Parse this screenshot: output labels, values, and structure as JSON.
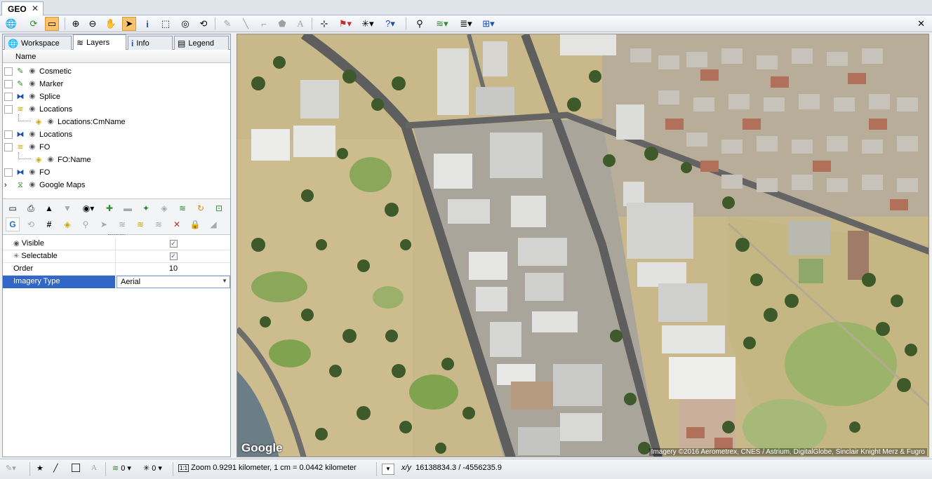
{
  "document_tab": {
    "title": "GEO",
    "close": "✕"
  },
  "toolbar": {
    "close": "✕"
  },
  "panel_tabs": [
    {
      "label": "Workspace",
      "icon": "globe-icon"
    },
    {
      "label": "Layers",
      "icon": "layers-icon"
    },
    {
      "label": "Info",
      "icon": "info-icon"
    },
    {
      "label": "Legend",
      "icon": "legend-icon"
    }
  ],
  "tree": {
    "column_header": "Name",
    "layers": [
      {
        "label": "Cosmetic",
        "icon": "cosmetic-layer-icon",
        "child": false
      },
      {
        "label": "Marker",
        "icon": "marker-layer-icon",
        "child": false
      },
      {
        "label": "Splice",
        "icon": "splice-layer-icon",
        "child": false
      },
      {
        "label": "Locations",
        "icon": "locations-layer-icon",
        "child": false
      },
      {
        "label": "Locations:CmName",
        "icon": "label-tag-icon",
        "child": true
      },
      {
        "label": "Locations",
        "icon": "locations-layer-icon",
        "child": false
      },
      {
        "label": "FO",
        "icon": "fo-layer-icon",
        "child": false
      },
      {
        "label": "FO:Name",
        "icon": "label-tag-icon",
        "child": true
      },
      {
        "label": "FO",
        "icon": "fo-layer-icon",
        "child": false
      },
      {
        "label": "Google Maps",
        "icon": "google-maps-layer-icon",
        "child": false
      }
    ]
  },
  "properties": {
    "visible": {
      "name": "Visible",
      "checked": "✓"
    },
    "selectable": {
      "name": "Selectable",
      "checked": "✓"
    },
    "order": {
      "name": "Order",
      "value": "10"
    },
    "imagery_type": {
      "name": "Imagery Type",
      "value": "Aerial"
    }
  },
  "map": {
    "logo": "Google",
    "attribution": "Imagery ©2016 Aerometrex, CNES / Astrium, DigitalGlobe, Sinclair Knight Merz & Fugro"
  },
  "statusbar": {
    "layer_count": "0",
    "select_count": "0",
    "zoom_text": "Zoom 0.9291 kilometer, 1 cm = 0.0442 kilometer",
    "coord_label": "x/y",
    "coords": "16138834.3 / -4556235.9"
  },
  "colors": {
    "selection": "#3168c8",
    "active_tool": "#f7c26a",
    "grass_dry": "#c9b98a",
    "grass_green": "#7fa34f",
    "trees": "#3e5a2a"
  }
}
